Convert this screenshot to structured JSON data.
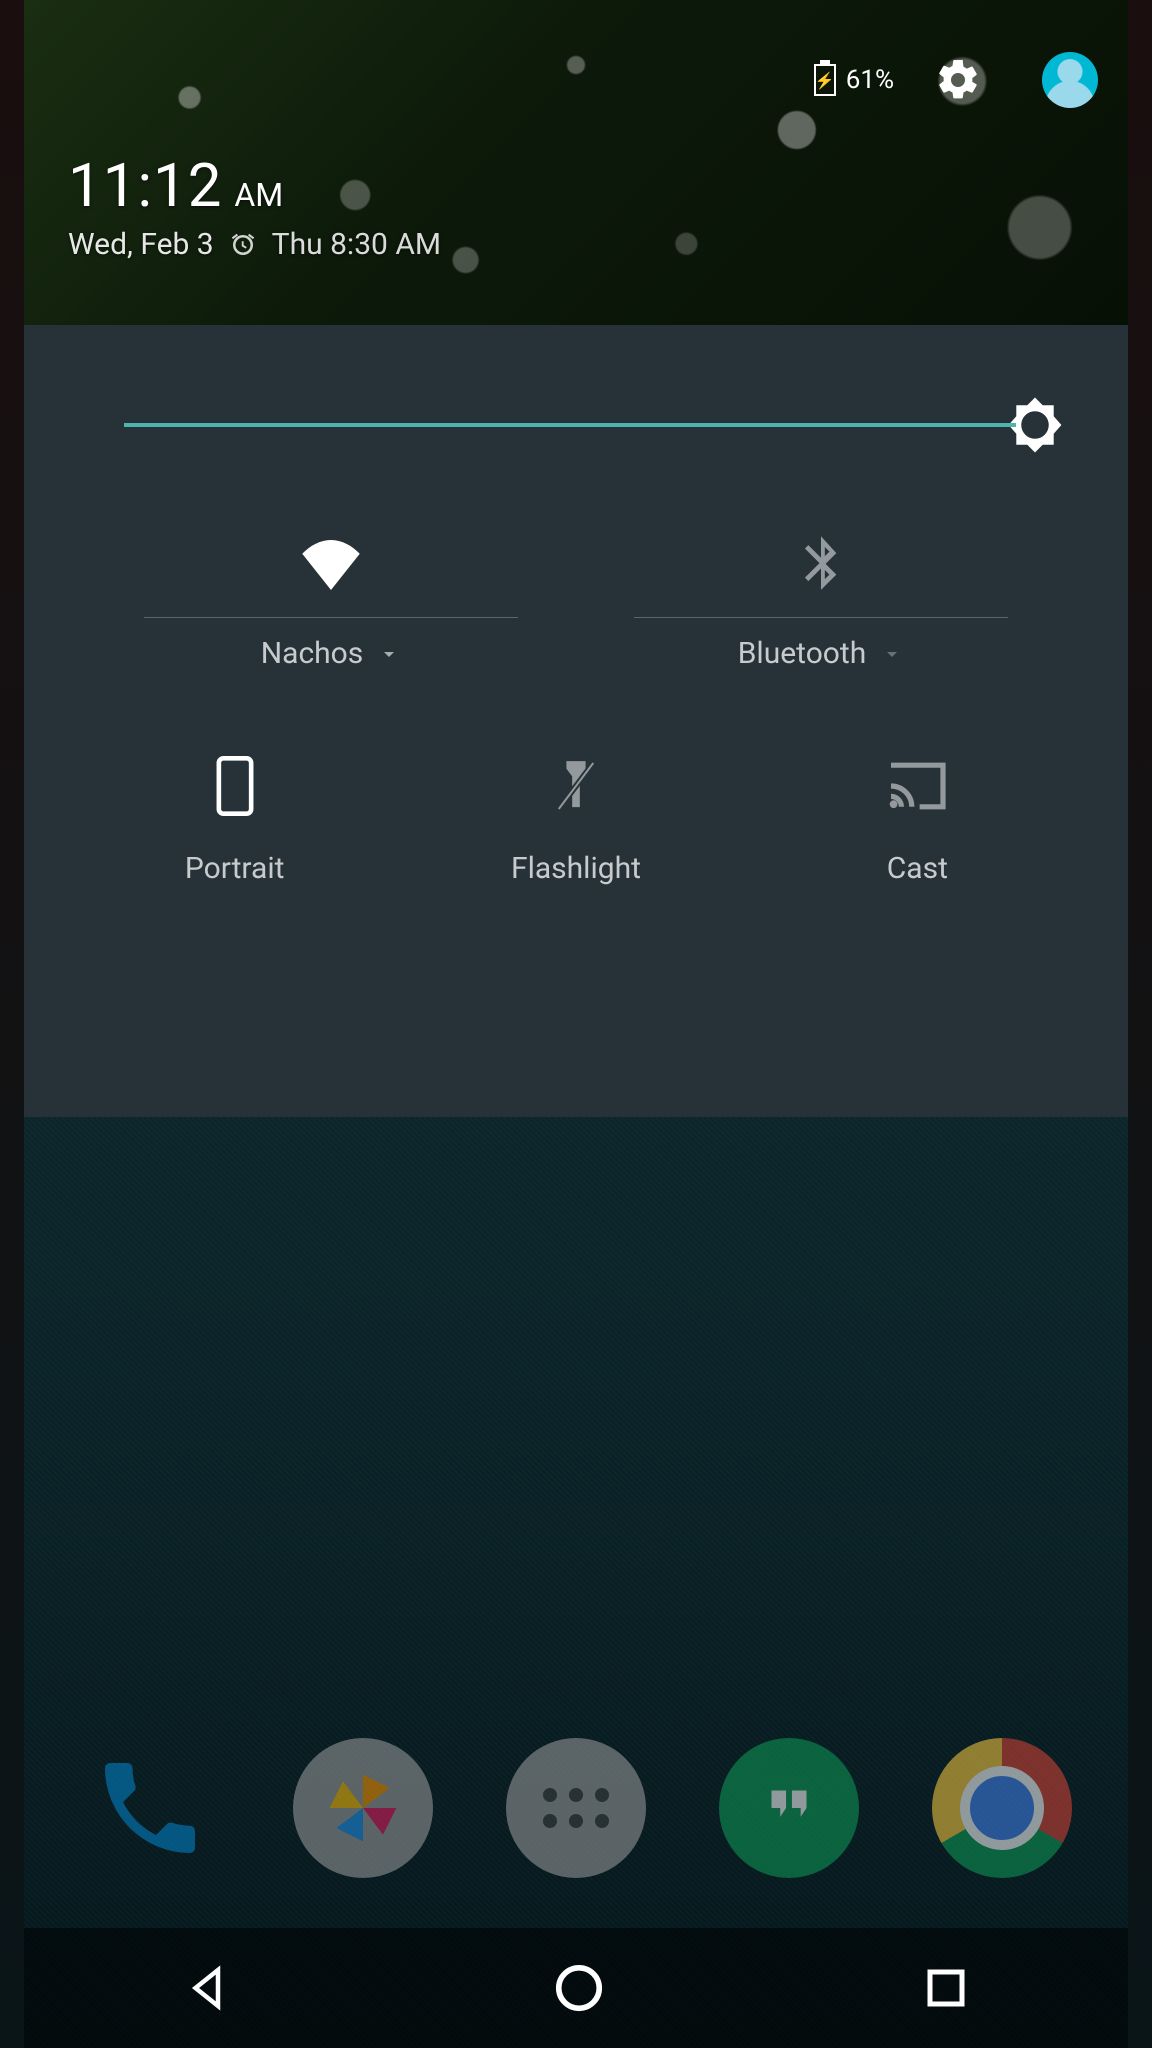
{
  "status": {
    "battery_pct": "61%",
    "icons": {
      "settings": "gear-icon",
      "profile": "avatar"
    }
  },
  "clock": {
    "time": "11:12",
    "ampm": "AM",
    "date": "Wed, Feb 3",
    "alarm": "Thu 8:30 AM"
  },
  "brightness": {
    "value_pct": 100
  },
  "quick_settings": {
    "wifi": {
      "label": "Nachos",
      "active": true
    },
    "bluetooth": {
      "label": "Bluetooth",
      "active": false
    },
    "tiles": [
      {
        "id": "portrait",
        "label": "Portrait",
        "active": true
      },
      {
        "id": "flashlight",
        "label": "Flashlight",
        "active": false
      },
      {
        "id": "cast",
        "label": "Cast",
        "active": false
      }
    ]
  },
  "dock": {
    "apps": [
      "phone",
      "gallery",
      "all-apps",
      "hangouts",
      "chrome"
    ]
  },
  "colors": {
    "panel_bg": "#263238",
    "accent": "#4db6ac",
    "avatar": "#00b8d4"
  }
}
